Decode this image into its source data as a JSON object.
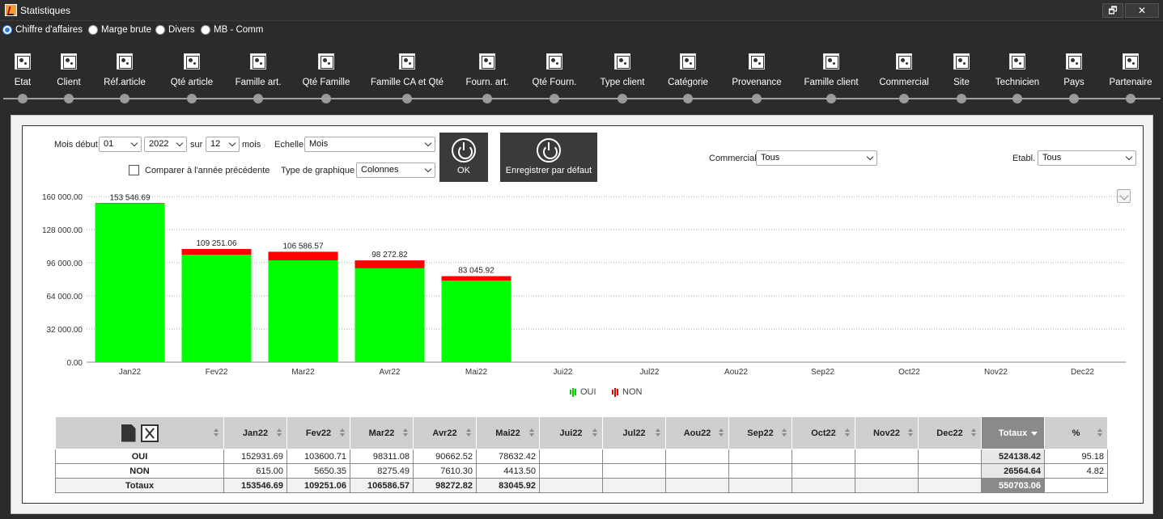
{
  "window": {
    "title": "Statistiques",
    "restore_label": "🗗",
    "close_label": "✕"
  },
  "modes": [
    {
      "label": "Chiffre d'affaires",
      "checked": true
    },
    {
      "label": "Marge brute",
      "checked": false
    },
    {
      "label": "Divers",
      "checked": false
    },
    {
      "label": "MB - Comm",
      "checked": false
    }
  ],
  "toolbar": [
    "Etat",
    "Client",
    "Réf.article",
    "Qté article",
    "Famille art.",
    "Qté Famille",
    "Famille CA et Qté",
    "Fourn. art.",
    "Qté Fourn.",
    "Type client",
    "Catégorie",
    "Provenance",
    "Famille client",
    "Commercial",
    "Site",
    "Technicien",
    "Pays",
    "Partenaire"
  ],
  "controls": {
    "mois_debut_label": "Mois début",
    "mois_debut_value": "01",
    "annee_value": "2022",
    "sur_label": "sur",
    "nb_mois_value": "12",
    "mois_label": "mois",
    "echelle_label": "Echelle",
    "echelle_value": "Mois",
    "comparer_label": "Comparer à l'année précédente",
    "type_graphique_label": "Type de graphique",
    "type_graphique_value": "Colonnes",
    "ok_label": "OK",
    "enregistrer_label": "Enregistrer par défaut",
    "commercial_label": "Commercial",
    "commercial_value": "Tous",
    "etabl_label": "Etabl.",
    "etabl_value": "Tous"
  },
  "colors": {
    "oui": "#00ff00",
    "non": "#ff0000",
    "dark_bg": "#2b2b2b",
    "accent": "#2a7be4"
  },
  "chart_data": {
    "type": "bar",
    "stacked": true,
    "categories": [
      "Jan22",
      "Fev22",
      "Mar22",
      "Avr22",
      "Mai22",
      "Jui22",
      "Jul22",
      "Aou22",
      "Sep22",
      "Oct22",
      "Nov22",
      "Dec22"
    ],
    "series": [
      {
        "name": "OUI",
        "color": "#00ff00",
        "values": [
          152931.69,
          103600.71,
          98311.08,
          90662.52,
          78632.42,
          null,
          null,
          null,
          null,
          null,
          null,
          null
        ]
      },
      {
        "name": "NON",
        "color": "#ff0000",
        "values": [
          615.0,
          5650.35,
          8275.49,
          7610.3,
          4413.5,
          null,
          null,
          null,
          null,
          null,
          null,
          null
        ]
      }
    ],
    "totals_labels": [
      "153 546.69",
      "109 251.06",
      "106 586.57",
      "98 272.82",
      "83 045.92"
    ],
    "yticks": [
      "0.00",
      "32 000.00",
      "64 000.00",
      "96 000.00",
      "128 000.00",
      "160 000.00"
    ],
    "ylim": [
      0,
      160000
    ],
    "grid": true,
    "legend_position": "bottom-center"
  },
  "table": {
    "headers": [
      "Jan22",
      "Fev22",
      "Mar22",
      "Avr22",
      "Mai22",
      "Jui22",
      "Jul22",
      "Aou22",
      "Sep22",
      "Oct22",
      "Nov22",
      "Dec22",
      "Totaux",
      "%"
    ],
    "rows": [
      {
        "label": "OUI",
        "cells": [
          "152931.69",
          "103600.71",
          "98311.08",
          "90662.52",
          "78632.42",
          "",
          "",
          "",
          "",
          "",
          "",
          ""
        ],
        "total": "524138.42",
        "pct": "95.18"
      },
      {
        "label": "NON",
        "cells": [
          "615.00",
          "5650.35",
          "8275.49",
          "7610.30",
          "4413.50",
          "",
          "",
          "",
          "",
          "",
          "",
          ""
        ],
        "total": "26564.64",
        "pct": "4.82"
      },
      {
        "label": "Totaux",
        "cells": [
          "153546.69",
          "109251.06",
          "106586.57",
          "98272.82",
          "83045.92",
          "",
          "",
          "",
          "",
          "",
          "",
          ""
        ],
        "total": "550703.06",
        "pct": ""
      }
    ]
  }
}
